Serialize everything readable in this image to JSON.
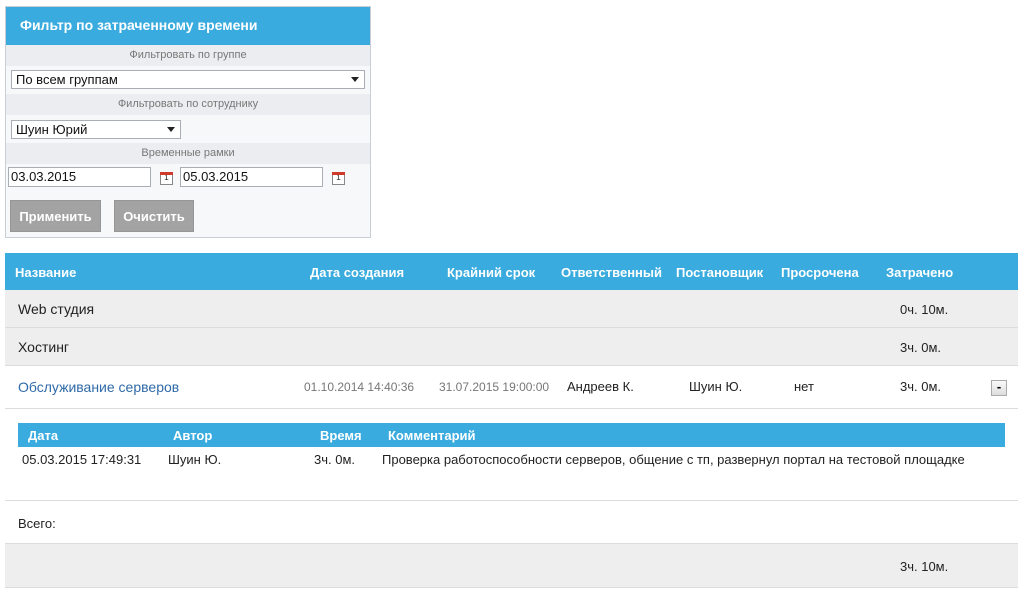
{
  "filter": {
    "title": "Фильтр по затраченному времени",
    "group_label": "Фильтровать по группе",
    "group_value": "По всем группам",
    "employee_label": "Фильтровать по сотруднику",
    "employee_value": "Шуин Юрий",
    "timeframe_label": "Временные рамки",
    "date_from": "03.03.2015",
    "date_to": "05.03.2015",
    "calendar_icon_text": "1",
    "apply_label": "Применить",
    "clear_label": "Очистить"
  },
  "report": {
    "columns": [
      "Название",
      "Дата создания",
      "Крайний срок",
      "Ответственный",
      "Постановщик",
      "Просрочена",
      "Затрачено"
    ],
    "groups": [
      {
        "name": "Web студия",
        "spent": "0ч. 10м."
      },
      {
        "name": "Хостинг",
        "spent": "3ч. 0м."
      }
    ],
    "task": {
      "name": "Обслуживание серверов",
      "created": "01.10.2014 14:40:36",
      "deadline": "31.07.2015 19:00:00",
      "responsible": "Андреев К.",
      "creator": "Шуин Ю.",
      "overdue": "нет",
      "spent": "3ч. 0м.",
      "toggle": "-"
    },
    "detail": {
      "columns": [
        "Дата",
        "Автор",
        "Время",
        "Комментарий"
      ],
      "rows": [
        {
          "date": "05.03.2015 17:49:31",
          "author": "Шуин Ю.",
          "time": "3ч. 0м.",
          "comment": "Проверка работоспособности серверов, общение с тп, развернул портал на тестовой площадке"
        }
      ]
    },
    "total_label": "Всего:",
    "total_value": "3ч. 10м."
  },
  "colors": {
    "header_blue": "#39abdf",
    "link_blue": "#2f6aa8",
    "button_gray": "#a3a3a3"
  }
}
